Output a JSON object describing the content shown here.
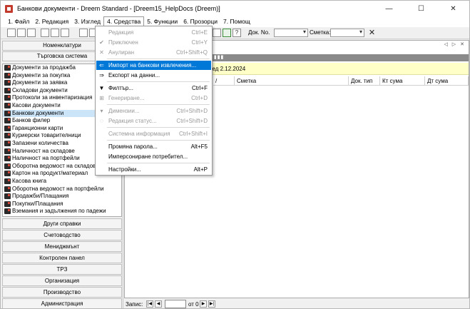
{
  "window": {
    "title": "Банкови документи - Dreem Standard - [Dreem15_HelpDocs (Dreem)]",
    "controls": {
      "minimize": "—",
      "maximize": "☐",
      "close": "✕"
    }
  },
  "menubar": {
    "items": [
      {
        "label": "1. Файл"
      },
      {
        "label": "2. Редакция"
      },
      {
        "label": "3. Изглед"
      },
      {
        "label": "4. Средства"
      },
      {
        "label": "5. Функции"
      },
      {
        "label": "6. Прозорци"
      },
      {
        "label": "7. Помощ"
      }
    ]
  },
  "toolbar": {
    "doc_no_label": "Док. No.",
    "account_label": "Сметка:",
    "help_glyph": "?",
    "close_glyph": "✕"
  },
  "sidebar": {
    "top_buttons": [
      "Номенклатури",
      "Търговска система"
    ],
    "modules": [
      "Документи за продажба",
      "Документи за покупка",
      "Документи за заявка",
      "Складови документи",
      "Протоколи за инвентаризация",
      "Касови документи",
      "Банкови документи",
      "Банков филер",
      "Гаранционни карти",
      "Куриерски товарителници",
      "Запазени количества",
      "Наличност на складове",
      "Наличност на портфейли",
      "Оборотна ведомост на складове",
      "Картон на продукт/материал",
      "Касова книга",
      "Оборотна ведомост на портфейли",
      "Продажби/Плащания",
      "Покупки/Плащания",
      "Вземания и задължения по падежи"
    ],
    "selected_module": "Банкови документи",
    "bottom_buttons": [
      "Други справки",
      "Счетоводство",
      "Мениджмънт",
      "Контролен панел",
      "ТРЗ",
      "Организация",
      "Производство",
      "Администрация"
    ]
  },
  "content": {
    "nav_arrows": "◁ ▷ ✕",
    "filter_text": "След 2.12.2024",
    "columns": [
      "/",
      "Сметка",
      "Док. тип",
      "Кт сума",
      "Дт сума"
    ]
  },
  "statusbar": {
    "label": "Запис:",
    "of_text": "от 0",
    "nav_first": "|◀",
    "nav_prev": "◀",
    "nav_next": "▶",
    "nav_last": "▶|"
  },
  "dropdown": {
    "items": [
      {
        "label": "Редакция",
        "shortcut": "Ctrl+E",
        "disabled": true
      },
      {
        "label": "Приключен",
        "shortcut": "Ctrl+Y",
        "disabled": true
      },
      {
        "label": "Анулиран",
        "shortcut": "Ctrl+Shift+Q",
        "disabled": true
      },
      {
        "label": "Импорт на банкови извлечения...",
        "shortcut": "",
        "disabled": false,
        "highlighted": true
      },
      {
        "label": "Експорт на данни...",
        "shortcut": "",
        "disabled": false
      },
      {
        "label": "Филтър...",
        "shortcut": "Ctrl+F",
        "disabled": false
      },
      {
        "label": "Генериране...",
        "shortcut": "Ctrl+D",
        "disabled": true
      },
      {
        "label": "Димензии...",
        "shortcut": "Ctrl+Shift+D",
        "disabled": true
      },
      {
        "label": "Редакция статус...",
        "shortcut": "Ctrl+Shift+D",
        "disabled": true
      },
      {
        "label": "Системна информация",
        "shortcut": "Ctrl+Shift+I",
        "disabled": true
      },
      {
        "label": "Промяна парола...",
        "shortcut": "Alt+F5",
        "disabled": false
      },
      {
        "label": "Имперсониране потребител...",
        "shortcut": "",
        "disabled": false
      },
      {
        "label": "Настройки...",
        "shortcut": "Alt+P",
        "disabled": false
      }
    ]
  },
  "colors": {
    "selection": "#cce4f7",
    "menu_highlight": "#0078d7",
    "filter_band": "#ffffc8",
    "header_band": "#8a8a8a",
    "disabled_text": "#9a9a9a"
  }
}
